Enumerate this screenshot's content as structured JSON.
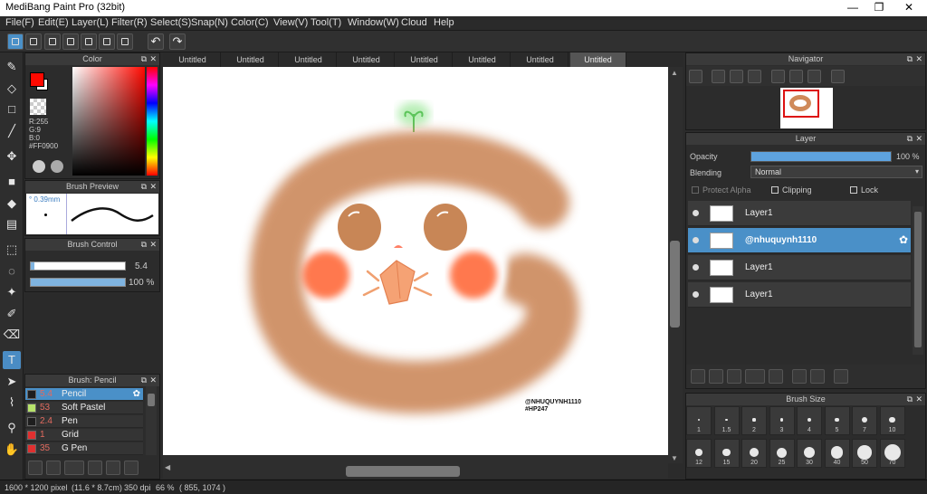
{
  "window": {
    "title": "MediBang Paint Pro (32bit)",
    "minimize": "—",
    "maximize": "❐",
    "close": "✕"
  },
  "menu": [
    "File(F)",
    "Edit(E)",
    "Layer(L)",
    "Filter(R)",
    "Select(S)",
    "Snap(N)",
    "Color(C)",
    "View(V)",
    "Tool(T)",
    "Window(W)",
    "Cloud",
    "Help"
  ],
  "tabs": [
    "Untitled",
    "Untitled",
    "Untitled",
    "Untitled",
    "Untitled",
    "Untitled",
    "Untitled",
    "Untitled"
  ],
  "color_panel": {
    "title": "Color",
    "r": "R:255",
    "g": "G:9",
    "b": "B:0",
    "hex": "#FF0900",
    "primary_color": "#FF0900",
    "secondary_color": "#FFFFFF"
  },
  "brush_preview": {
    "title": "Brush Preview",
    "size": "° 0.39mm"
  },
  "brush_control": {
    "title": "Brush Control",
    "size_value": "5.4",
    "opacity_value": "100 %",
    "size_level": 0.04,
    "opacity_level": 1.0
  },
  "brush_list": {
    "title": "Brush: Pencil",
    "items": [
      {
        "size": "5.4",
        "name": "Pencil",
        "color": "#1e1e1e"
      },
      {
        "size": "53",
        "name": "Soft Pastel",
        "color": "#b7e36b"
      },
      {
        "size": "2.4",
        "name": "Pen",
        "color": "#1e1e1e"
      },
      {
        "size": "1",
        "name": "Grid",
        "color": "#e03030"
      },
      {
        "size": "35",
        "name": "G Pen",
        "color": "#e03030"
      }
    ]
  },
  "canvas": {
    "watermark_line1": "@NHUQUYNH1110",
    "watermark_line2": "#HP247"
  },
  "navigator": {
    "title": "Navigator"
  },
  "layer_panel": {
    "title": "Layer",
    "opacity_label": "Opacity",
    "opacity_value": "100 %",
    "opacity_level": 1.0,
    "blending_label": "Blending",
    "blending_value": "Normal",
    "protect_alpha": "Protect Alpha",
    "clipping": "Clipping",
    "lock": "Lock",
    "layers": [
      {
        "name": "Layer1",
        "selected": false
      },
      {
        "name": "@nhuquynh1110",
        "selected": true
      },
      {
        "name": "Layer1",
        "selected": false
      },
      {
        "name": "Layer1",
        "selected": false
      }
    ]
  },
  "brush_size": {
    "title": "Brush Size",
    "sizes": [
      "1",
      "1.5",
      "2",
      "3",
      "4",
      "5",
      "7",
      "10",
      "12",
      "15",
      "20",
      "25",
      "30",
      "40",
      "50",
      "70"
    ]
  },
  "status": {
    "dimensions": "1600 * 1200 pixel",
    "physical": "(11.6 * 8.7cm)",
    "dpi": "350 dpi",
    "zoom": "66 %",
    "cursor": "( 855, 1074 )"
  },
  "colors": {
    "accent": "#4A90C8",
    "panel_bg": "#2C2C2C",
    "header_bg": "#3A3A3A"
  }
}
